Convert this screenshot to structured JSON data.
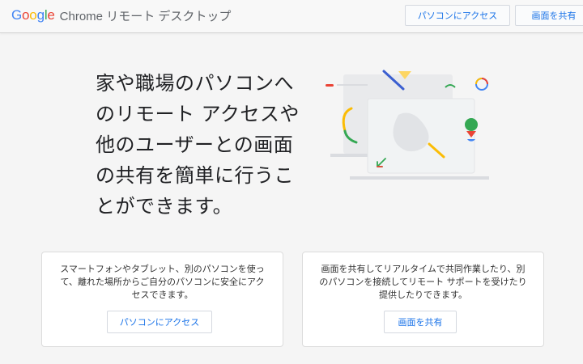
{
  "header": {
    "logo_letters": [
      {
        "ch": "G",
        "color": "#4285f4"
      },
      {
        "ch": "o",
        "color": "#ea4335"
      },
      {
        "ch": "o",
        "color": "#fbbc05"
      },
      {
        "ch": "g",
        "color": "#4285f4"
      },
      {
        "ch": "l",
        "color": "#34a853"
      },
      {
        "ch": "e",
        "color": "#ea4335"
      }
    ],
    "product_name": "Chrome リモート デスクトップ",
    "access_button": "パソコンにアクセス",
    "share_button": "画面を共有"
  },
  "hero": {
    "lines": [
      "家や職場のパソコンへ",
      "のリモート アクセスや",
      "他のユーザーとの画面",
      "の共有を簡単に行うこ",
      "とができます。"
    ],
    "illustration_icon": "devices-illustration"
  },
  "cards": [
    {
      "description": "スマートフォンやタブレット、別のパソコンを使って、離れた場所からご自分のパソコンに安全にアクセスできます。",
      "button": "パソコンにアクセス"
    },
    {
      "description": "画面を共有してリアルタイムで共同作業したり、別のパソコンを接続してリモート サポートを受けたり提供したりできます。",
      "button": "画面を共有"
    }
  ],
  "colors": {
    "accent": "#1a73e8",
    "background": "#f5f5f5",
    "google_blue": "#4285f4",
    "google_red": "#ea4335",
    "google_yellow": "#fbbc05",
    "google_green": "#34a853"
  }
}
